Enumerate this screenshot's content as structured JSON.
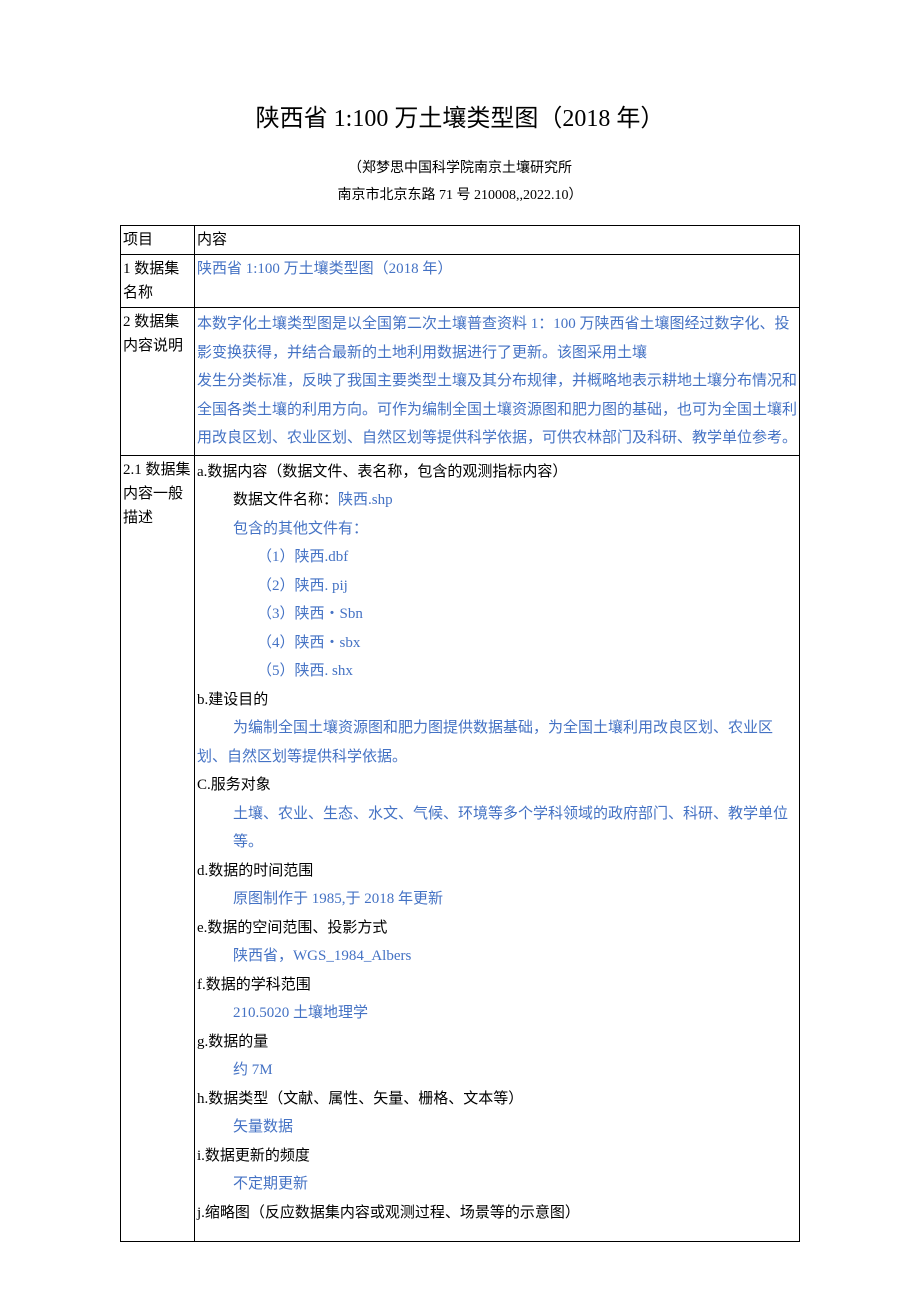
{
  "title": "陕西省 1:100 万土壤类型图（2018 年）",
  "author_line": "（郑梦思中国科学院南京土壤研究所",
  "address_line": "南京市北京东路 71 号 210008,,2022.10）",
  "header": {
    "col1": "项目",
    "col2": "内容"
  },
  "row1": {
    "label": "1 数据集名称",
    "value": "陕西省 1:100 万土壤类型图（2018 年）"
  },
  "row2": {
    "label": "2 数据集内容说明",
    "para1": "本数字化土壤类型图是以全国第二次土壤普查资料 1：100 万陕西省土壤图经过数字化、投影变换获得，并结合最新的土地利用数据进行了更新。该图采用土壤",
    "para2": "发生分类标准，反映了我国主要类型土壤及其分布规律，并概略地表示耕地土壤分布情况和全国各类土壤的利用方向。可作为编制全国土壤资源图和肥力图的基础，也可为全国土壤利用改良区划、农业区划、自然区划等提供科学依据，可供农林部门及科研、教学单位参考。"
  },
  "row3": {
    "label": "2.1 数据集内容一般描述",
    "a": {
      "label": "a.数据内容（数据文件、表名称，包含的观测指标内容）",
      "file_label": "数据文件名称：",
      "file_name": "陕西.shp",
      "other_label": "包含的其他文件有：",
      "files": [
        "（1）陕西.dbf",
        "（2）陕西. pij",
        "（3）陕西・Sbn",
        "（4）陕西・sbx",
        "（5）陕西. shx"
      ]
    },
    "b": {
      "label": "b.建设目的",
      "value": "为编制全国土壤资源图和肥力图提供数据基础，为全国土壤利用改良区划、农业区划、自然区划等提供科学依据。"
    },
    "c": {
      "label": "C.服务对象",
      "value": "土壤、农业、生态、水文、气候、环境等多个学科领域的政府部门、科研、教学单位等。"
    },
    "d": {
      "label": "d.数据的时间范围",
      "value": "原图制作于 1985,于 2018 年更新"
    },
    "e": {
      "label": "e.数据的空间范围、投影方式",
      "value": "陕西省，WGS_1984_Albers"
    },
    "f": {
      "label": "f.数据的学科范围",
      "value": "210.5020 土壤地理学"
    },
    "g": {
      "label": "g.数据的量",
      "value": "约 7M"
    },
    "h": {
      "label": "h.数据类型（文献、属性、矢量、栅格、文本等）",
      "value": "矢量数据"
    },
    "i": {
      "label": "i.数据更新的频度",
      "value": "不定期更新"
    },
    "j": {
      "label": "j.缩略图（反应数据集内容或观测过程、场景等的示意图）"
    }
  }
}
